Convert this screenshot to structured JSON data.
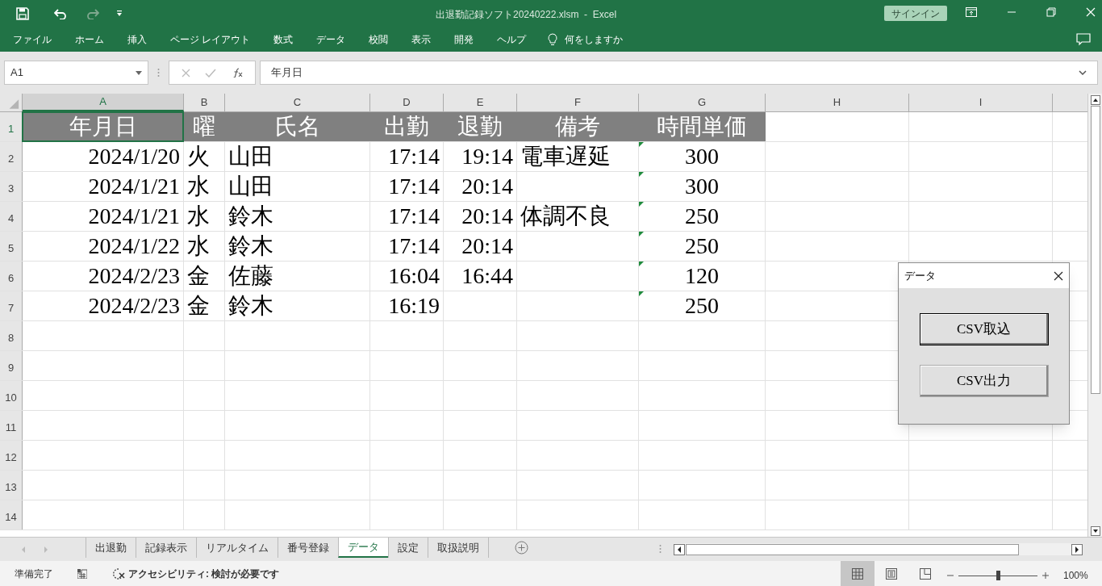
{
  "window": {
    "title": "出退勤記録ソフト20240222.xlsm  -  Excel",
    "sign_in": "サインイン"
  },
  "ribbon_tabs": [
    "ファイル",
    "ホーム",
    "挿入",
    "ページ レイアウト",
    "数式",
    "データ",
    "校閲",
    "表示",
    "開発",
    "ヘルプ"
  ],
  "tell_me": "何をしますか",
  "name_box": "A1",
  "formula": "年月日",
  "columns": [
    {
      "label": "A",
      "selected": true
    },
    {
      "label": "B",
      "selected": false
    },
    {
      "label": "C",
      "selected": false
    },
    {
      "label": "D",
      "selected": false
    },
    {
      "label": "E",
      "selected": false
    },
    {
      "label": "F",
      "selected": false
    },
    {
      "label": "G",
      "selected": false
    },
    {
      "label": "H",
      "selected": false
    },
    {
      "label": "I",
      "selected": false
    }
  ],
  "rows": [
    {
      "number": "1",
      "selected": true,
      "kind": "header",
      "flag": false,
      "cells": [
        "年月日",
        "曜",
        "氏名",
        "出勤",
        "退勤",
        "備考",
        "時間単価"
      ]
    },
    {
      "number": "2",
      "selected": false,
      "kind": "data",
      "flag": true,
      "cells": [
        "2024/1/20",
        "火",
        "山田",
        "17:14",
        "19:14",
        "電車遅延",
        "300"
      ]
    },
    {
      "number": "3",
      "selected": false,
      "kind": "data",
      "flag": true,
      "cells": [
        "2024/1/21",
        "水",
        "山田",
        "17:14",
        "20:14",
        null,
        "300"
      ]
    },
    {
      "number": "4",
      "selected": false,
      "kind": "data",
      "flag": true,
      "cells": [
        "2024/1/21",
        "水",
        "鈴木",
        "17:14",
        "20:14",
        "体調不良",
        "250"
      ]
    },
    {
      "number": "5",
      "selected": false,
      "kind": "data",
      "flag": true,
      "cells": [
        "2024/1/22",
        "水",
        "鈴木",
        "17:14",
        "20:14",
        null,
        "250"
      ]
    },
    {
      "number": "6",
      "selected": false,
      "kind": "data",
      "flag": true,
      "cells": [
        "2024/2/23",
        "金",
        "佐藤",
        "16:04",
        "16:44",
        null,
        "120"
      ]
    },
    {
      "number": "7",
      "selected": false,
      "kind": "data",
      "flag": true,
      "cells": [
        "2024/2/23",
        "金",
        "鈴木",
        "16:19",
        null,
        null,
        "250"
      ]
    },
    {
      "number": "8",
      "selected": false,
      "kind": "empty",
      "flag": false
    },
    {
      "number": "9",
      "selected": false,
      "kind": "empty",
      "flag": false
    },
    {
      "number": "10",
      "selected": false,
      "kind": "empty",
      "flag": false
    },
    {
      "number": "11",
      "selected": false,
      "kind": "empty",
      "flag": false
    },
    {
      "number": "12",
      "selected": false,
      "kind": "empty",
      "flag": false
    },
    {
      "number": "13",
      "selected": false,
      "kind": "empty",
      "flag": false
    },
    {
      "number": "14",
      "selected": false,
      "kind": "empty",
      "flag": false
    }
  ],
  "sheet_tabs": [
    {
      "label": "出退勤",
      "selected": false
    },
    {
      "label": "記録表示",
      "selected": false
    },
    {
      "label": "リアルタイム",
      "selected": false
    },
    {
      "label": "番号登録",
      "selected": false
    },
    {
      "label": "データ",
      "selected": true
    },
    {
      "label": "設定",
      "selected": false
    },
    {
      "label": "取扱説明",
      "selected": false
    }
  ],
  "status_bar": {
    "ready": "準備完了",
    "accessibility": "アクセシビリティ: 検討が必要です",
    "views": [
      {
        "kind": "normal",
        "selected": true
      },
      {
        "kind": "page_layout",
        "selected": false
      },
      {
        "kind": "page_break",
        "selected": false
      }
    ],
    "zoom": {
      "level": 0.5,
      "reading": "100%"
    }
  },
  "dialog": {
    "title": "データ",
    "buttons": [
      {
        "label": "CSV取込",
        "focused": true
      },
      {
        "label": "CSV出力",
        "focused": false
      }
    ]
  }
}
